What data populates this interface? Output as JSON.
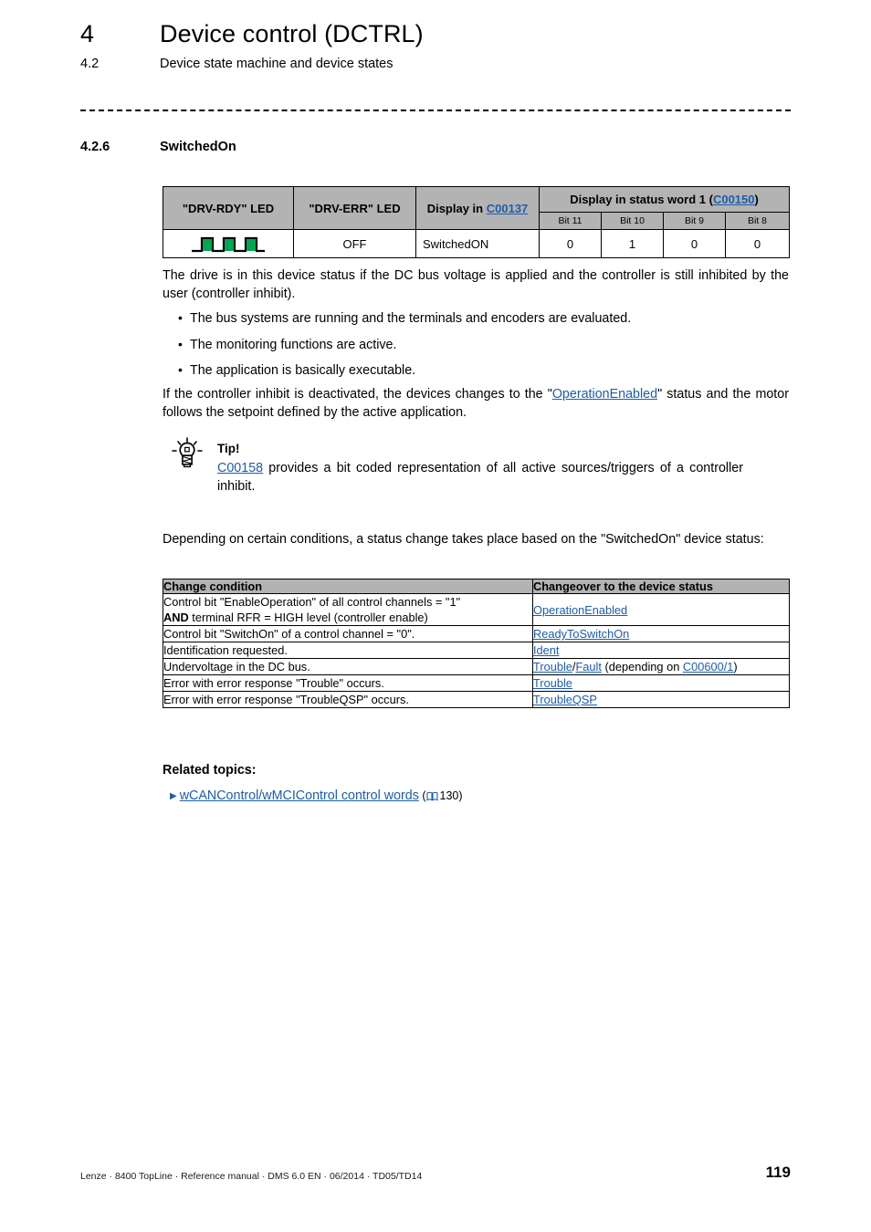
{
  "header": {
    "chapter_number": "4",
    "chapter_title": "Device control (DCTRL)",
    "section_number": "4.2",
    "section_title": "Device state machine and device states"
  },
  "section": {
    "number": "4.2.6",
    "title": "SwitchedOn"
  },
  "status_table": {
    "headers": {
      "drv_rdy": "\"DRV-RDY\" LED",
      "drv_err": "\"DRV-ERR\" LED",
      "display_c00137_prefix": "Display in ",
      "display_c00137_link": "C00137",
      "status_word_prefix": "Display in status word 1 (",
      "status_word_link": "C00150",
      "status_word_suffix": ")",
      "bits": [
        "Bit 11",
        "Bit 10",
        "Bit 9",
        "Bit 8"
      ]
    },
    "row": {
      "drv_rdy_icon": "led-blink-3-pulse-icon",
      "drv_rdy_color": "#00a651",
      "drv_err": "OFF",
      "display_c00137": "SwitchedON",
      "bits": [
        "0",
        "1",
        "0",
        "0"
      ]
    }
  },
  "body": {
    "intro": "The drive is in this device status if the DC bus voltage is applied and the controller is still inhibited by the user (controller inhibit).",
    "bullets": [
      "The bus systems are running and the terminals and encoders are evaluated.",
      "The monitoring functions are active.",
      "The application is basically executable."
    ],
    "inhibit_para_before": "If the controller inhibit is deactivated, the devices changes to the \"",
    "inhibit_para_link": "OperationEnabled",
    "inhibit_para_after": "\" status and the motor follows the setpoint defined by the active application.",
    "conditions_para": "Depending on certain conditions, a status change takes place based on the \"SwitchedOn\" device status:"
  },
  "tip": {
    "icon": "lightbulb-icon",
    "label": "Tip!",
    "link": "C00158",
    "text": " provides a bit coded representation of all active sources/triggers of a controller inhibit."
  },
  "change_table": {
    "headers": [
      "Change condition",
      "Changeover to the device status"
    ],
    "rows": [
      {
        "condition_line1": "Control bit \"EnableOperation\" of all control channels = \"1\"",
        "condition_bold": "AND",
        "condition_line2_rest": " terminal RFR = HIGH level (controller enable)",
        "status_links": [
          "OperationEnabled"
        ],
        "status_suffix": ""
      },
      {
        "condition_line1": "Control bit \"SwitchOn\" of a control channel = \"0\".",
        "condition_bold": "",
        "condition_line2_rest": "",
        "status_links": [
          "ReadyToSwitchOn"
        ],
        "status_suffix": ""
      },
      {
        "condition_line1": "Identification requested.",
        "condition_bold": "",
        "condition_line2_rest": "",
        "status_links": [
          "Ident"
        ],
        "status_suffix": ""
      },
      {
        "condition_line1": "Undervoltage in the DC bus.",
        "condition_bold": "",
        "condition_line2_rest": "",
        "status_links": [
          "Trouble",
          "Fault",
          "C00600/1"
        ],
        "status_suffix": " (depending on "
      },
      {
        "condition_line1": "Error with error response \"Trouble\" occurs.",
        "condition_bold": "",
        "condition_line2_rest": "",
        "status_links": [
          "Trouble"
        ],
        "status_suffix": ""
      },
      {
        "condition_line1": "Error with error response \"TroubleQSP\" occurs.",
        "condition_bold": "",
        "condition_line2_rest": "",
        "status_links": [
          "TroubleQSP"
        ],
        "status_suffix": ""
      }
    ]
  },
  "related": {
    "heading": "Related topics:",
    "item_link": "wCANControl/wMCIControl control words",
    "item_page": "130",
    "item_icon": "book-icon",
    "bullet_icon": "triangle-right-icon"
  },
  "footer": {
    "text": "Lenze · 8400 TopLine · Reference manual · DMS 6.0 EN · 06/2014 · TD05/TD14",
    "page": "119"
  },
  "colors": {
    "link": "#1d5dab",
    "table_header_bg": "#b3b3b3",
    "led_green": "#00a651"
  }
}
